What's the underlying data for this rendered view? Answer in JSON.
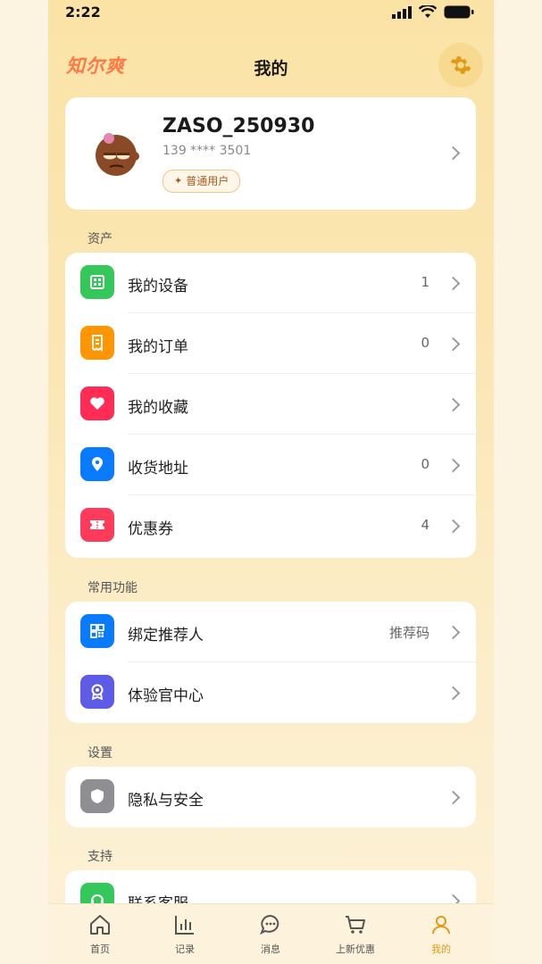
{
  "status": {
    "time": "2:22"
  },
  "header": {
    "logo": "知尔爽",
    "title": "我的"
  },
  "profile": {
    "name": "ZASO_250930",
    "phone": "139 **** 3501",
    "badge": "普通用户"
  },
  "sections": {
    "assets": {
      "title": "资产",
      "items": [
        {
          "label": "我的设备",
          "value": "1",
          "icon": "device-icon",
          "color": "#34c759"
        },
        {
          "label": "我的订单",
          "value": "0",
          "icon": "order-icon",
          "color": "#ff9500"
        },
        {
          "label": "我的收藏",
          "value": "",
          "icon": "heart-icon",
          "color": "#ff2d55"
        },
        {
          "label": "收货地址",
          "value": "0",
          "icon": "location-icon",
          "color": "#0a7aff"
        },
        {
          "label": "优惠券",
          "value": "4",
          "icon": "coupon-icon",
          "color": "#ff3b5c"
        }
      ]
    },
    "common": {
      "title": "常用功能",
      "items": [
        {
          "label": "绑定推荐人",
          "value": "推荐码",
          "icon": "qrcode-icon",
          "color": "#0a7aff"
        },
        {
          "label": "体验官中心",
          "value": "",
          "icon": "medal-icon",
          "color": "#5e5ce6"
        }
      ]
    },
    "settings": {
      "title": "设置",
      "items": [
        {
          "label": "隐私与安全",
          "value": "",
          "icon": "shield-icon",
          "color": "#8e8e93"
        }
      ]
    },
    "support": {
      "title": "支持",
      "items": [
        {
          "label": "联系客服",
          "value": "",
          "icon": "headset-icon",
          "color": "#34c759"
        }
      ]
    }
  },
  "tabs": [
    {
      "label": "首页",
      "icon": "home-icon"
    },
    {
      "label": "记录",
      "icon": "chart-icon"
    },
    {
      "label": "消息",
      "icon": "message-icon"
    },
    {
      "label": "上新优惠",
      "icon": "cart-icon"
    },
    {
      "label": "我的",
      "icon": "user-icon",
      "active": true
    }
  ],
  "colors": {
    "accent": "#e09a16",
    "background": "#fbe6b3"
  }
}
